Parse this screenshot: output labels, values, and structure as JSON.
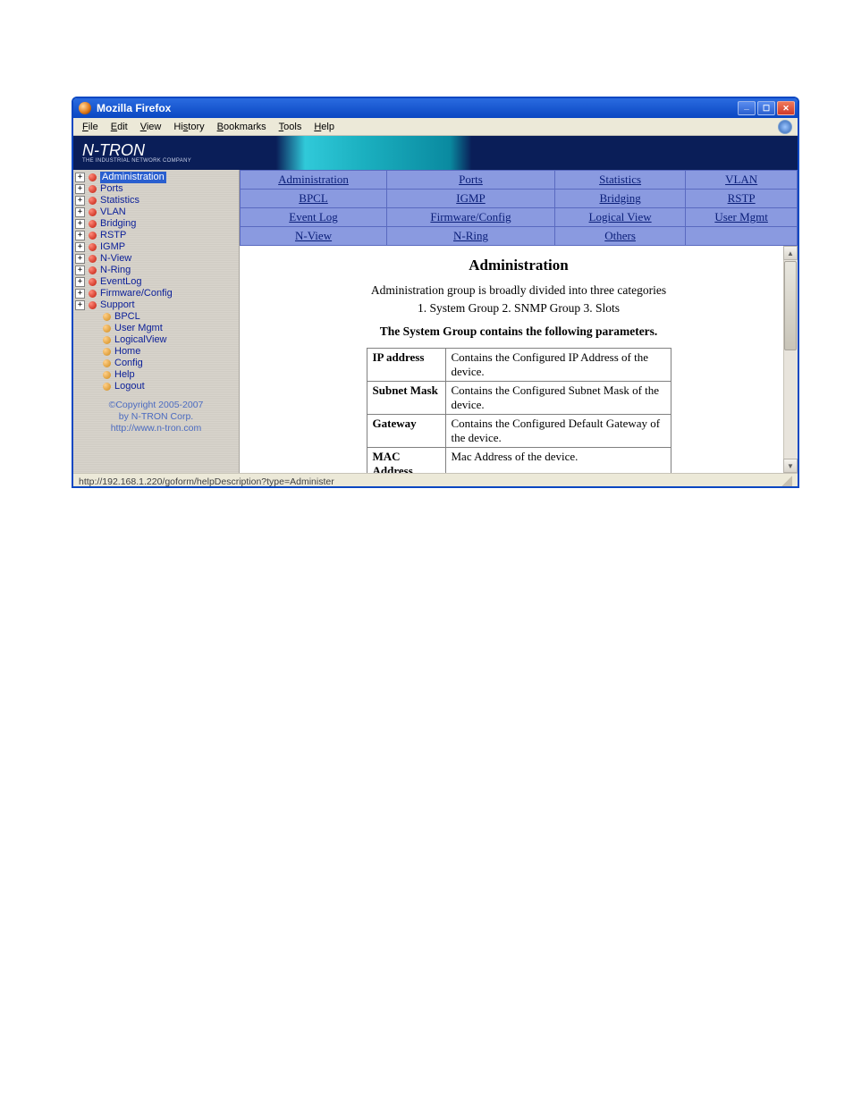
{
  "window": {
    "title": "Mozilla Firefox"
  },
  "menu": [
    "File",
    "Edit",
    "View",
    "History",
    "Bookmarks",
    "Tools",
    "Help"
  ],
  "brand": {
    "name": "N-TRON",
    "tag": "THE INDUSTRIAL NETWORK COMPANY"
  },
  "sidebar": {
    "items": [
      {
        "label": "Administration",
        "exp": true,
        "dot": "red",
        "sel": true
      },
      {
        "label": "Ports",
        "exp": true,
        "dot": "red"
      },
      {
        "label": "Statistics",
        "exp": true,
        "dot": "red"
      },
      {
        "label": "VLAN",
        "exp": true,
        "dot": "red"
      },
      {
        "label": "Bridging",
        "exp": true,
        "dot": "red"
      },
      {
        "label": "RSTP",
        "exp": true,
        "dot": "red"
      },
      {
        "label": "IGMP",
        "exp": true,
        "dot": "red"
      },
      {
        "label": "N-View",
        "exp": true,
        "dot": "red"
      },
      {
        "label": "N-Ring",
        "exp": true,
        "dot": "red"
      },
      {
        "label": "EventLog",
        "exp": true,
        "dot": "red"
      },
      {
        "label": "Firmware/Config",
        "exp": true,
        "dot": "red"
      },
      {
        "label": "Support",
        "exp": true,
        "dot": "red"
      },
      {
        "label": "BPCL",
        "exp": false,
        "dot": "ora",
        "child": true
      },
      {
        "label": "User Mgmt",
        "exp": false,
        "dot": "ora",
        "child": true
      },
      {
        "label": "LogicalView",
        "exp": false,
        "dot": "ora",
        "child": true
      },
      {
        "label": "Home",
        "exp": false,
        "dot": "ora",
        "child": true
      },
      {
        "label": "Config",
        "exp": false,
        "dot": "ora",
        "child": true
      },
      {
        "label": "Help",
        "exp": false,
        "dot": "ora",
        "child": true
      },
      {
        "label": "Logout",
        "exp": false,
        "dot": "ora",
        "child": true
      }
    ],
    "copyright": {
      "line1": "©Copyright 2005-2007",
      "line2": "by N-TRON Corp.",
      "url": "http://www.n-tron.com"
    }
  },
  "tabs": [
    [
      "Administration",
      "Ports",
      "Statistics",
      "VLAN"
    ],
    [
      "BPCL",
      "IGMP",
      "Bridging",
      "RSTP"
    ],
    [
      "Event Log",
      "Firmware/Config",
      "Logical View",
      "User Mgmt"
    ],
    [
      "N-View",
      "N-Ring",
      "Others",
      ""
    ]
  ],
  "page": {
    "heading": "Administration",
    "desc": "Administration group is broadly divided into three categories",
    "categories": "1. System Group   2. SNMP Group   3. Slots",
    "subhead": "The System Group contains the following parameters.",
    "params": [
      {
        "k": "IP address",
        "v": "Contains the Configured IP Address of the device."
      },
      {
        "k": "Subnet Mask",
        "v": "Contains the Configured Subnet Mask of the device."
      },
      {
        "k": "Gateway",
        "v": "Contains the Configured Default Gateway of the device."
      },
      {
        "k": "MAC Address",
        "v": "Mac Address of the device."
      }
    ]
  },
  "status": "http://192.168.1.220/goform/helpDescription?type=Administer"
}
